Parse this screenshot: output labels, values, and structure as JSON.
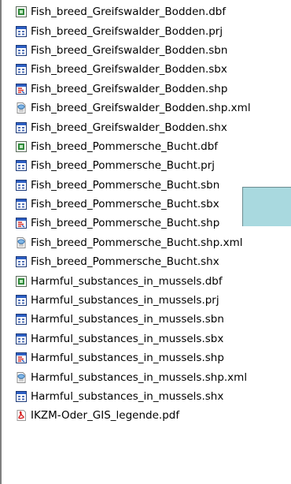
{
  "files": [
    {
      "name": "Fish_breed_Greifswalder_Bodden.dbf",
      "icon": "dbf-icon"
    },
    {
      "name": "Fish_breed_Greifswalder_Bodden.prj",
      "icon": "generic-file-icon"
    },
    {
      "name": "Fish_breed_Greifswalder_Bodden.sbn",
      "icon": "generic-file-icon"
    },
    {
      "name": "Fish_breed_Greifswalder_Bodden.sbx",
      "icon": "generic-file-icon"
    },
    {
      "name": "Fish_breed_Greifswalder_Bodden.shp",
      "icon": "shapefile-icon"
    },
    {
      "name": "Fish_breed_Greifswalder_Bodden.shp.xml",
      "icon": "xml-icon"
    },
    {
      "name": "Fish_breed_Greifswalder_Bodden.shx",
      "icon": "generic-file-icon"
    },
    {
      "name": "Fish_breed_Pommersche_Bucht.dbf",
      "icon": "dbf-icon"
    },
    {
      "name": "Fish_breed_Pommersche_Bucht.prj",
      "icon": "generic-file-icon"
    },
    {
      "name": "Fish_breed_Pommersche_Bucht.sbn",
      "icon": "generic-file-icon"
    },
    {
      "name": "Fish_breed_Pommersche_Bucht.sbx",
      "icon": "generic-file-icon"
    },
    {
      "name": "Fish_breed_Pommersche_Bucht.shp",
      "icon": "shapefile-icon"
    },
    {
      "name": "Fish_breed_Pommersche_Bucht.shp.xml",
      "icon": "xml-icon"
    },
    {
      "name": "Fish_breed_Pommersche_Bucht.shx",
      "icon": "generic-file-icon"
    },
    {
      "name": "Harmful_substances_in_mussels.dbf",
      "icon": "dbf-icon"
    },
    {
      "name": "Harmful_substances_in_mussels.prj",
      "icon": "generic-file-icon"
    },
    {
      "name": "Harmful_substances_in_mussels.sbn",
      "icon": "generic-file-icon"
    },
    {
      "name": "Harmful_substances_in_mussels.sbx",
      "icon": "generic-file-icon"
    },
    {
      "name": "Harmful_substances_in_mussels.shp",
      "icon": "shapefile-icon"
    },
    {
      "name": "Harmful_substances_in_mussels.shp.xml",
      "icon": "xml-icon"
    },
    {
      "name": "Harmful_substances_in_mussels.shx",
      "icon": "generic-file-icon"
    },
    {
      "name": "IKZM-Oder_GIS_legende.pdf",
      "icon": "pdf-icon"
    }
  ],
  "colors": {
    "tooltip_fill": "#a9d9df",
    "icon_frame": "#1c3a7a",
    "icon_header": "#2d5fc4",
    "dbf_green": "#2f8a3a",
    "shp_red": "#d8302a",
    "pdf_red": "#d61f1f"
  }
}
